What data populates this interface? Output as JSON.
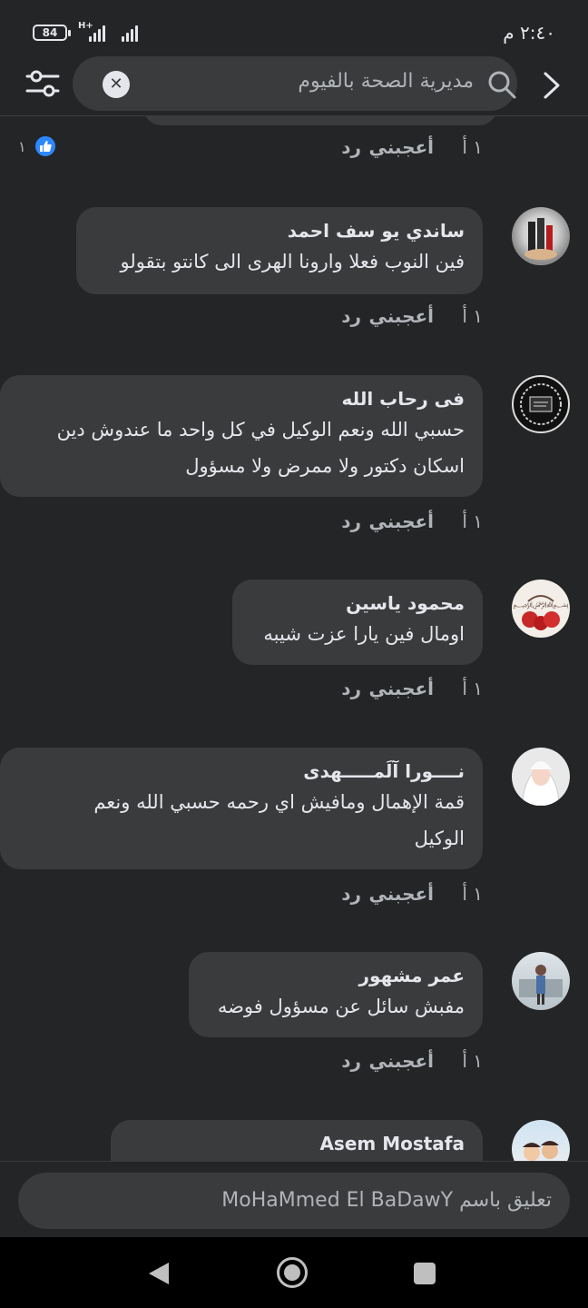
{
  "status_bar": {
    "battery": "84",
    "network": "H+",
    "time": "٢:٤٠ م"
  },
  "search": {
    "query": "مديرية الصحة بالفيوم"
  },
  "actions": {
    "like_label": "أعجبني",
    "reply_label": "رد"
  },
  "first_row": {
    "time": "١ أ",
    "reaction_count": "١"
  },
  "comments": [
    {
      "author": "ساندي يو سف احمد",
      "lines": [
        "فين النوب فعلا وارونا الهرى الى كانتو بتقولو"
      ],
      "time": "١ أ"
    },
    {
      "author": "فى رحاب الله",
      "lines": [
        "حسبي الله ونعم الوكيل في كل واحد ما عندوش دين",
        "اسكان دكتور ولا ممرض ولا مسؤول"
      ],
      "time": "١ أ"
    },
    {
      "author": "محمود ياسين",
      "lines": [
        "اومال فين يارا عزت شيبه"
      ],
      "time": "١ أ"
    },
    {
      "author": "نــــورا آلَمـــــهدى",
      "lines": [
        "قمة الإهمال ومافيش اي رحمه حسبي الله ونعم",
        "الوكيل"
      ],
      "time": "١ أ"
    },
    {
      "author": "عمر مشهور",
      "lines": [
        "مفبش سائل عن مسؤول فوضه"
      ],
      "time": "١ أ"
    },
    {
      "author": "Asem Mostafa",
      "lines": [],
      "time": ""
    }
  ],
  "comment_bar": {
    "placeholder": "تعليق باسم MoHaMmed El BaDawY"
  }
}
